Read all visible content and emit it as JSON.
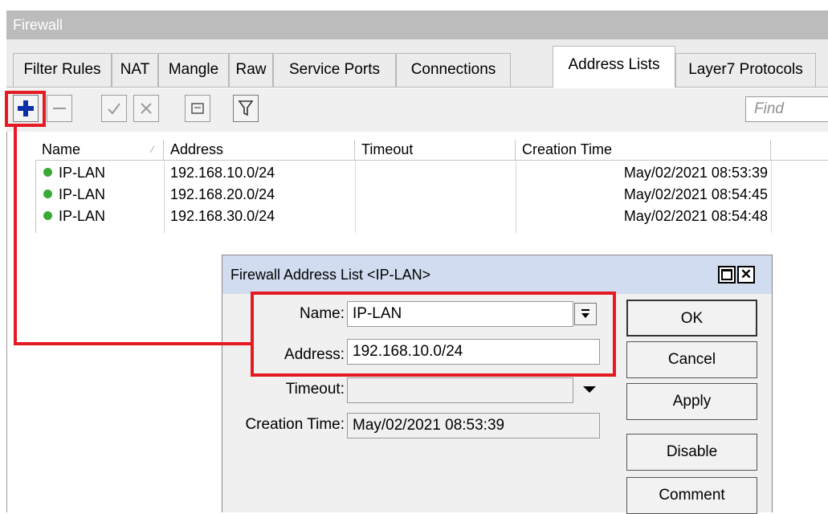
{
  "window": {
    "title": "Firewall"
  },
  "tabs": [
    {
      "label": "Filter Rules"
    },
    {
      "label": "NAT"
    },
    {
      "label": "Mangle"
    },
    {
      "label": "Raw"
    },
    {
      "label": "Service Ports"
    },
    {
      "label": "Connections"
    },
    {
      "label": "Address Lists"
    },
    {
      "label": "Layer7 Protocols"
    }
  ],
  "active_tab": "Address Lists",
  "toolbar": {
    "add_icon": "plus-icon",
    "remove_icon": "minus-icon",
    "enable_icon": "check-icon",
    "disable_icon": "cross-icon",
    "comment_icon": "comment-icon",
    "filter_icon": "filter-icon",
    "find_placeholder": "Find"
  },
  "table": {
    "columns": [
      "Name",
      "Address",
      "Timeout",
      "Creation Time"
    ],
    "rows": [
      {
        "name": "IP-LAN",
        "address": "192.168.10.0/24",
        "timeout": "",
        "creation_time": "May/02/2021 08:53:39"
      },
      {
        "name": "IP-LAN",
        "address": "192.168.20.0/24",
        "timeout": "",
        "creation_time": "May/02/2021 08:54:45"
      },
      {
        "name": "IP-LAN",
        "address": "192.168.30.0/24",
        "timeout": "",
        "creation_time": "May/02/2021 08:54:48"
      }
    ]
  },
  "dialog": {
    "title": "Firewall Address List <IP-LAN>",
    "name_label": "Name:",
    "name_value": "IP-LAN",
    "address_label": "Address:",
    "address_value": "192.168.10.0/24",
    "timeout_label": "Timeout:",
    "timeout_value": "",
    "creation_label": "Creation Time:",
    "creation_value": "May/02/2021 08:53:39",
    "buttons": {
      "ok": "OK",
      "cancel": "Cancel",
      "apply": "Apply",
      "disable": "Disable",
      "comment": "Comment"
    }
  },
  "colors": {
    "highlight_red": "#e51b24",
    "add_icon_blue": "#0a2fa8",
    "status_green": "#3aaa35",
    "dialog_title_bg": "#d1dcf0"
  }
}
